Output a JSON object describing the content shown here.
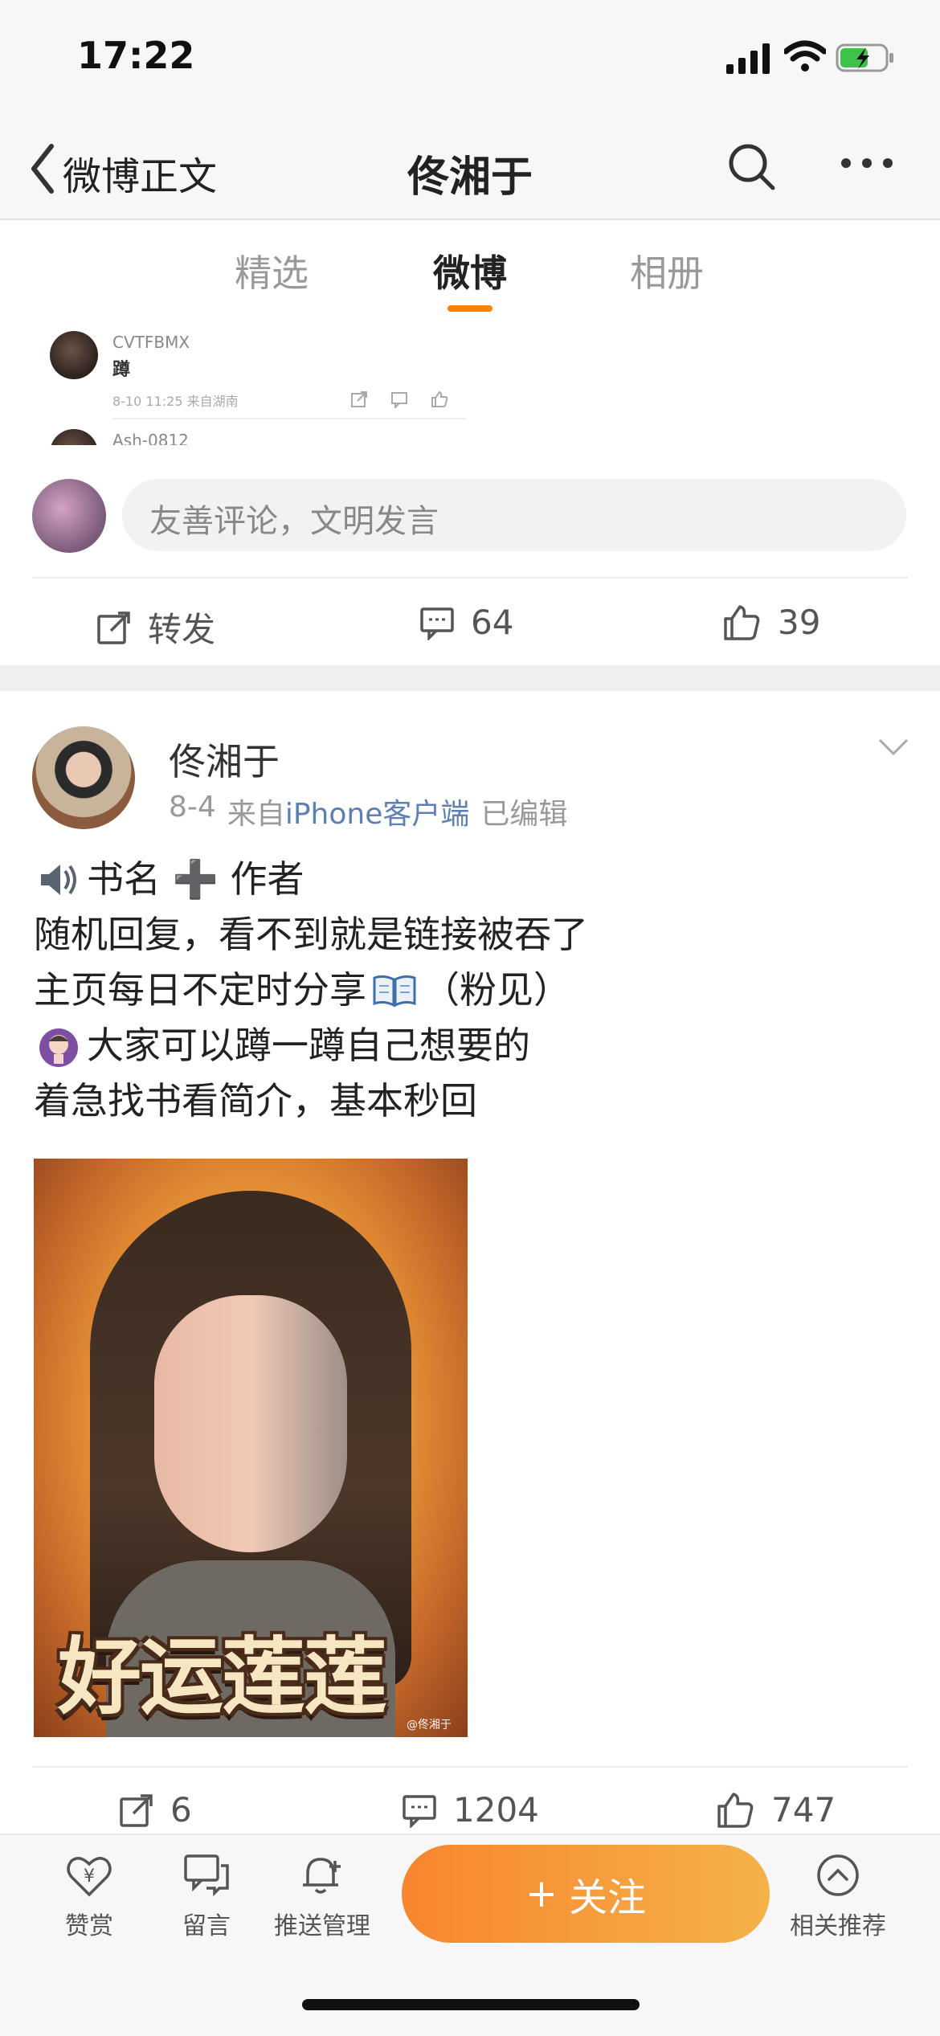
{
  "status_bar": {
    "time": "17:22"
  },
  "nav": {
    "back_label": "微博正文",
    "title": "佟湘于",
    "search_icon": "search-icon",
    "more_icon": "more-icon"
  },
  "tabs": [
    {
      "label": "精选"
    },
    {
      "label": "微博",
      "active": true
    },
    {
      "label": "相册"
    }
  ],
  "mini_comments": [
    {
      "name": "CVTFBMX",
      "text": "蹲",
      "meta": "8-10 11:25  来自湖南"
    },
    {
      "name": "Ash-0812"
    }
  ],
  "comment_input": {
    "placeholder": "友善评论，文明发言"
  },
  "prev_actions": {
    "repost": "转发",
    "comments": "64",
    "likes": "39"
  },
  "post": {
    "author": "佟湘于",
    "date": "8-4",
    "from": "来自",
    "source": "iPhone客户端",
    "edited": "已编辑",
    "lines": [
      "书名 ➕ 作者",
      "随机回复，看不到就是链接被吞了",
      "主页每日不定时分享",
      "（粉见）",
      "大家可以蹲一蹲自己想要的",
      "着急找书看简介，基本秒回"
    ],
    "image_caption": "好运莲莲",
    "image_watermark": "@佟湘于",
    "reposts": "6",
    "comments": "1204",
    "likes": "747"
  },
  "bottom_bar": {
    "reward": "赞赏",
    "message": "留言",
    "push": "推送管理",
    "follow": "关注",
    "follow_plus": "+",
    "related": "相关推荐"
  },
  "colors": {
    "accent": "#ff8200",
    "link": "#5d7fb5",
    "follow_gradient_start": "#f8852f",
    "follow_gradient_end": "#f4b249"
  }
}
